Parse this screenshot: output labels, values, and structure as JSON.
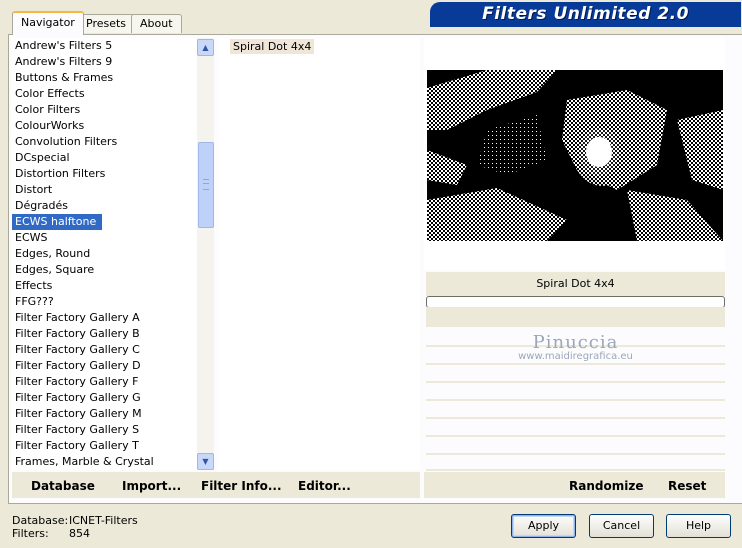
{
  "tabs": [
    {
      "label": "Navigator",
      "active": true
    },
    {
      "label": "Presets",
      "active": false
    },
    {
      "label": "About",
      "active": false
    }
  ],
  "app_title": "Filters Unlimited 2.0",
  "categories": [
    "Andrew's Filters 5",
    "Andrew's Filters 9",
    "Buttons & Frames",
    "Color Effects",
    "Color Filters",
    "ColourWorks",
    "Convolution Filters",
    "DCspecial",
    "Distortion Filters",
    "Distort",
    "Dégradés",
    "ECWS halftone",
    "ECWS",
    "Edges, Round",
    "Edges, Square",
    "Effects",
    "FFG???",
    "Filter Factory Gallery A",
    "Filter Factory Gallery B",
    "Filter Factory Gallery C",
    "Filter Factory Gallery D",
    "Filter Factory Gallery F",
    "Filter Factory Gallery G",
    "Filter Factory Gallery M",
    "Filter Factory Gallery S",
    "Filter Factory Gallery T",
    "Frames, Marble & Crystal"
  ],
  "selected_category": "ECWS halftone",
  "filters": [
    "Spiral Dot 4x4"
  ],
  "selected_filter_name": "Spiral Dot 4x4",
  "watermark": {
    "name": "Pinuccia",
    "site": "www.maidiregrafica.eu"
  },
  "bottom_bar": {
    "database": "Database",
    "import": "Import...",
    "filter_info": "Filter Info...",
    "editor": "Editor...",
    "randomize": "Randomize",
    "reset": "Reset"
  },
  "status": {
    "database_label": "Database:",
    "database_value": "ICNET-Filters",
    "filters_label": "Filters:",
    "filters_value": "854"
  },
  "buttons": {
    "apply": "Apply",
    "cancel": "Cancel",
    "help": "Help"
  },
  "colors": {
    "selection": "#316ac5",
    "title_bg": "#083a97",
    "tab_accent": "#f7b73f"
  },
  "icons": {
    "scroll_up": "▲",
    "scroll_down": "▼"
  }
}
